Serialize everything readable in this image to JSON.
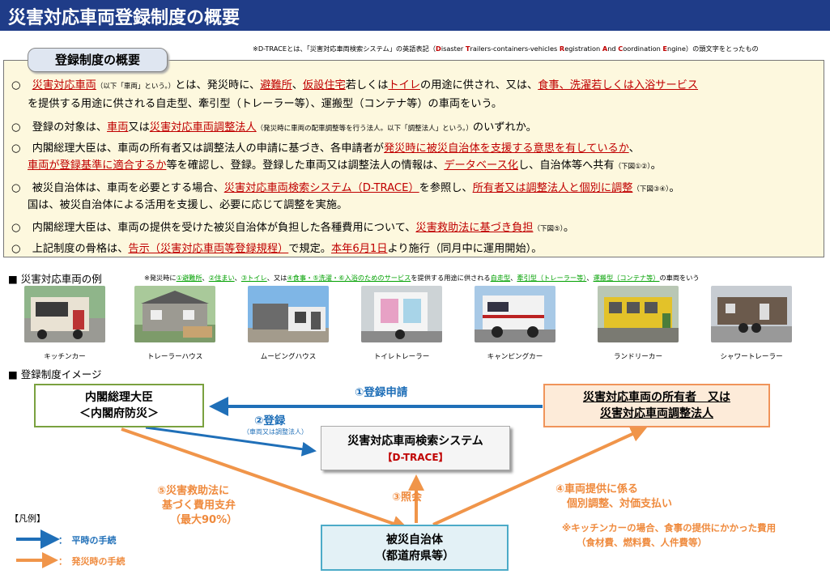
{
  "title": "災害対応車両登録制度の概要",
  "top_note": {
    "p1": "※D-TRACEとは、「災害対応車両検索システム」の英語表記（",
    "d": "D",
    "p2": "isaster ",
    "t": "T",
    "p3": "railers-containers-vehicles ",
    "r": "R",
    "p4": "egistration ",
    "a": "A",
    "p5": "nd ",
    "c": "C",
    "p6": "oordination ",
    "e": "E",
    "p7": "ngine）の頭文字をとったもの"
  },
  "overview_title": "登録制度の概要",
  "bullet": "○",
  "b1": {
    "r1": "災害対応車両",
    "s1": "（以下「車両」という。）",
    "t1": "とは、発災時に、",
    "r2": "避難所",
    "t2": "、",
    "r3": "仮設住宅",
    "t3": "若しくは",
    "r4": "トイレ",
    "t4": "の用途に供され、又は、",
    "r5": "食事、洗濯若しくは入浴サービス",
    "line2": "を提供する用途に供される自走型、牽引型（トレーラー等）、運搬型（コンテナ等）の車両をいう。"
  },
  "b2": {
    "t1": "登録の対象は、",
    "r1": "車両",
    "t2": "又は",
    "r2": "災害対応車両調整法人",
    "s1": "（発災時に車両の配車調整等を行う法人。以下「調整法人」という。）",
    "t3": "のいずれか。"
  },
  "b3": {
    "t1": "内閣総理大臣は、車両の所有者又は調整法人の申請に基づき、各申請者が",
    "r1": "発災時に被災自治体を支援する意思を有しているか",
    "t2": "、",
    "r2": "車両が登録基準に適合するか",
    "t3": "等を確認し、登録。登録した車両又は調整法人の情報は、",
    "r3": "データベース化",
    "t4": "し、自治体等へ共有",
    "s1": "（下図①②）",
    "t5": "。"
  },
  "b4": {
    "t1": "被災自治体は、車両を必要とする場合、",
    "r1": "災害対応車両検索システム（D-TRACE）",
    "t2": "を参照し、",
    "r2": "所有者又は調整法人と個別に調整",
    "s1": "（下図③④）",
    "t3": "。",
    "line2": "国は、被災自治体による活用を支援し、必要に応じて調整を実施。"
  },
  "b5": {
    "t1": "内閣総理大臣は、車両の提供を受けた被災自治体が負担した各種費用について、",
    "r1": "災害救助法に基づき負担",
    "s1": "（下図⑤）",
    "t2": "。"
  },
  "b6": {
    "t1": "上記制度の骨格は、",
    "r1": "告示（災害対応車両等登録規程）",
    "t2": "で規定。",
    "r2": "本年6月1日",
    "t3": "より施行（同月中に運用開始）。"
  },
  "examples_heading": "■ 災害対応車両の例",
  "examples_note": {
    "p1": "※発災時に",
    "g1": "①避難所",
    "p2": "、",
    "g2": "②住まい",
    "p3": "、",
    "g3": "③トイレ",
    "p4": "、又は",
    "g4": "④食事・⑤洗濯・⑥入浴のためのサービス",
    "p5": "を提供する用途に供される",
    "g5": "自走型",
    "p6": "、",
    "g6": "牽引型（トレーラー等）",
    "p7": "、",
    "g7": "運搬型（コンテナ等）",
    "p8": "の車両をいう"
  },
  "vehicles": [
    "キッチンカー",
    "トレーラーハウス",
    "ムービングハウス",
    "トイレトレーラー",
    "キャンピングカー",
    "ランドリーカー",
    "シャワートレーラー"
  ],
  "image_heading": "■ 登録制度イメージ",
  "diagram": {
    "cabinet_line1": "内閣総理大臣",
    "cabinet_line2": "＜内閣府防災＞",
    "owner_line1": "災害対応車両の所有者　又は",
    "owner_line2": "災害対応車両調整法人",
    "system_line1": "災害対応車両検索システム",
    "system_line2": "【D-TRACE】",
    "local_line1": "被災自治体",
    "local_line2": "（都道府県等）",
    "f1": "①登録申請",
    "f2": "②登録",
    "f2_sub": "（車両又は調整法人）",
    "f3": "③照会",
    "f4_line1": "④車両提供に係る",
    "f4_line2": "個別調整、対価支払い",
    "f4_note1": "※キッチンカーの場合、食事の提供にかかった費用",
    "f4_note2": "（食材費、燃料費、人件費等）",
    "f5_line1": "⑤災害救助法に",
    "f5_line2": "基づく費用支弁",
    "f5_line3": "（最大90%）"
  },
  "legend": {
    "title": "【凡例】",
    "normal": "：　平時の手続",
    "disaster": "：　発災時の手続"
  },
  "colors": {
    "title_bg": "#1f3c88",
    "highlight_red": "#c00000",
    "blue_arrow": "#1f6fb8",
    "orange_arrow": "#f0954a",
    "green": "#00a000"
  }
}
